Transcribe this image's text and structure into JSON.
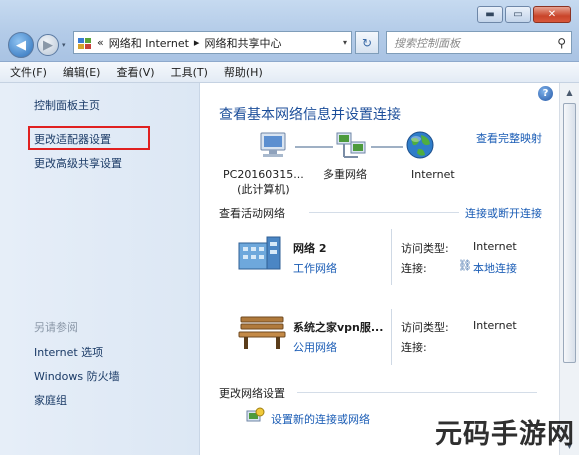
{
  "window": {
    "minimize_glyph": "▬",
    "maximize_glyph": "▭",
    "close_glyph": "✕"
  },
  "nav": {
    "back_glyph": "◀",
    "forward_glyph": "▶",
    "dropdown_glyph": "▾"
  },
  "address": {
    "prefix": "«",
    "crumbs": [
      "网络和 Internet",
      "网络和共享中心"
    ],
    "separator": "▸",
    "dropdown_glyph": "▾"
  },
  "refresh_glyph": "↻",
  "search": {
    "placeholder": "搜索控制面板",
    "icon_glyph": "⚲"
  },
  "menu": [
    "文件(F)",
    "编辑(E)",
    "查看(V)",
    "工具(T)",
    "帮助(H)"
  ],
  "sidebar": {
    "items": [
      "控制面板主页",
      "更改适配器设置",
      "更改高级共享设置"
    ],
    "see_also": "另请参阅",
    "see_also_items": [
      "Internet 选项",
      "Windows 防火墙",
      "家庭组"
    ]
  },
  "main": {
    "help_glyph": "?",
    "title": "查看基本网络信息并设置连接",
    "full_map": "查看完整映射",
    "map_nodes": [
      {
        "line1": "PC20160315...",
        "line2": "(此计算机)"
      },
      {
        "line1": "多重网络",
        "line2": ""
      },
      {
        "line1": "Internet",
        "line2": ""
      }
    ],
    "active_heading": "查看活动网络",
    "connect_link": "连接或断开连接",
    "networks": [
      {
        "name": "网络  2",
        "type": "工作网络",
        "k1": "访问类型:",
        "v1": "Internet",
        "k2": "连接:",
        "v2": "本地连接"
      },
      {
        "name": "系统之家vpn服...",
        "type": "公用网络",
        "k1": "访问类型:",
        "v1": "Internet",
        "k2": "连接:",
        "v2": ""
      }
    ],
    "change_heading": "更改网络设置",
    "setup_link": "设置新的连接或网络"
  },
  "scrollbar": {
    "up_glyph": "▲",
    "down_glyph": "▼"
  },
  "watermark": "元码手游网",
  "colors": {
    "link": "#1a5cb5",
    "title": "#1c4e9a",
    "highlight_box": "#e02020"
  }
}
